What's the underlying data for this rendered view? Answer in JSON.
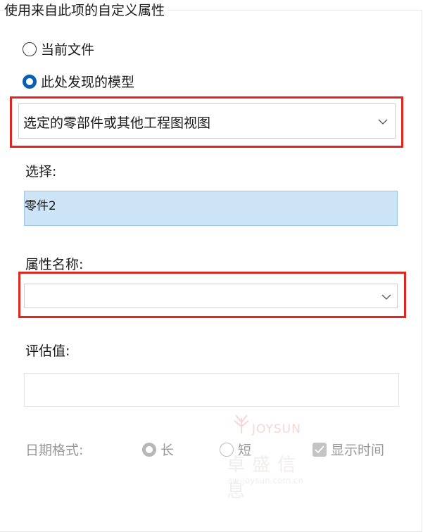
{
  "group": {
    "title": "使用来自此项的自定义属性"
  },
  "source": {
    "options": [
      {
        "label": "当前文件",
        "checked": false
      },
      {
        "label": "此处发现的模型",
        "checked": true
      }
    ]
  },
  "model_combo": {
    "value": "选定的零部件或其他工程图视图",
    "icon": "chevron-down-icon"
  },
  "selection": {
    "label": "选择:",
    "value": "零件2"
  },
  "property": {
    "label": "属性名称:",
    "value": "",
    "icon": "chevron-down-icon"
  },
  "evaluated": {
    "label": "评估值:",
    "value": ""
  },
  "date_format": {
    "label": "日期格式:",
    "options": [
      {
        "label": "长",
        "checked": true
      },
      {
        "label": "短",
        "checked": false
      }
    ],
    "show_time": {
      "label": "显示时间",
      "checked": true
    }
  },
  "watermark": {
    "brand": "JOYSUN",
    "name": "卓盛信息",
    "url": "sw-joysun.com.cn"
  },
  "colors": {
    "highlight": "#e1261c",
    "accent": "#0a5fb4",
    "selection_bg": "#cde4f7"
  }
}
